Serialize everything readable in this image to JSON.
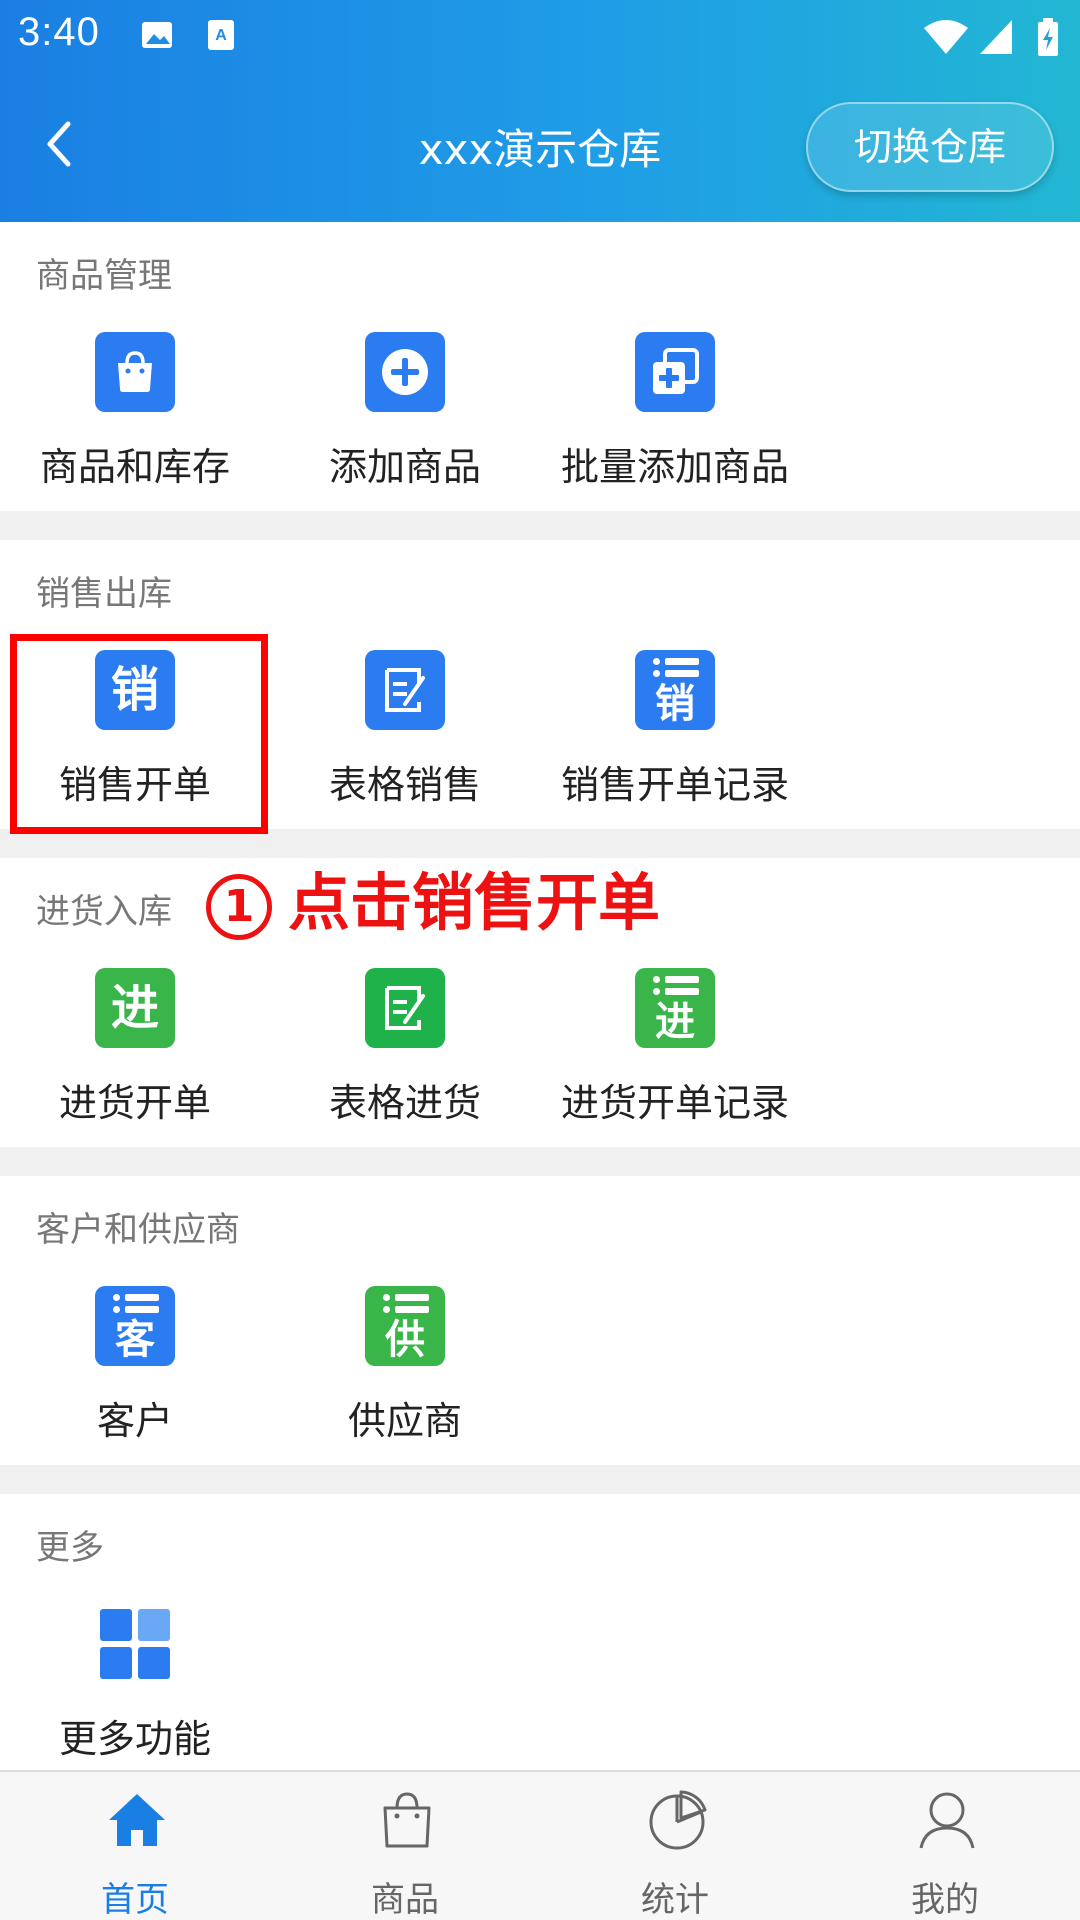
{
  "status": {
    "time": "3:40"
  },
  "header": {
    "title": "xxx演示仓库",
    "switch_label": "切换仓库"
  },
  "sections": [
    {
      "title": "商品管理",
      "items": [
        {
          "label": "商品和库存",
          "icon": "shopping-bag-icon",
          "color": "#2b7cf0"
        },
        {
          "label": "添加商品",
          "icon": "plus-circle-icon",
          "color": "#2b7cf0"
        },
        {
          "label": "批量添加商品",
          "icon": "batch-add-icon",
          "color": "#2b7cf0"
        }
      ]
    },
    {
      "title": "销售出库",
      "items": [
        {
          "label": "销售开单",
          "icon": "sales-order-icon",
          "glyph": "销",
          "color": "#2b7cf0"
        },
        {
          "label": "表格销售",
          "icon": "edit-form-icon",
          "color": "#2b7cf0"
        },
        {
          "label": "销售开单记录",
          "icon": "sales-record-icon",
          "glyph": "销",
          "color": "#2b7cf0"
        }
      ]
    },
    {
      "title": "进货入库",
      "items": [
        {
          "label": "进货开单",
          "icon": "purchase-order-icon",
          "glyph": "进",
          "color": "#3ab54a"
        },
        {
          "label": "表格进货",
          "icon": "edit-form-icon",
          "color": "#3ab54a"
        },
        {
          "label": "进货开单记录",
          "icon": "purchase-record-icon",
          "glyph": "进",
          "color": "#3ab54a"
        }
      ]
    },
    {
      "title": "客户和供应商",
      "items": [
        {
          "label": "客户",
          "icon": "customer-icon",
          "glyph": "客",
          "color": "#2b7cf0"
        },
        {
          "label": "供应商",
          "icon": "supplier-icon",
          "glyph": "供",
          "color": "#3ab54a"
        }
      ]
    },
    {
      "title": "更多",
      "items": [
        {
          "label": "更多功能",
          "icon": "grid-icon",
          "color": "#2b7cf0"
        }
      ]
    }
  ],
  "annotation": {
    "number": "1",
    "text": "点击销售开单",
    "color": "#ee1111"
  },
  "bottom_nav": [
    {
      "label": "首页",
      "icon": "home-icon",
      "active": true
    },
    {
      "label": "商品",
      "icon": "bag-icon",
      "active": false
    },
    {
      "label": "统计",
      "icon": "pie-chart-icon",
      "active": false
    },
    {
      "label": "我的",
      "icon": "user-icon",
      "active": false
    }
  ],
  "colors": {
    "accent": "#1a7fe3",
    "green": "#3ab54a",
    "annotation": "#ee1111"
  }
}
